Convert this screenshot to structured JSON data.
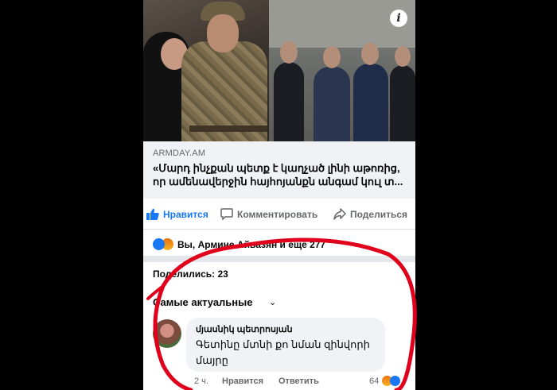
{
  "link": {
    "domain": "ARMDAY.AM",
    "title": "«Մարդ ինչքան պետք է կաղչած լինի աթոռից, որ ամենավերջին հայհոյանքն անգամ կուլ տ..."
  },
  "actions": {
    "like_label": "Нравится",
    "comment_label": "Комментировать",
    "share_label": "Поделиться"
  },
  "reactions": {
    "summary": "Вы, Армине Айвазян и ещё 277"
  },
  "shares": {
    "label": "Поделились: 23"
  },
  "sort": {
    "label": "Самые актуальные"
  },
  "comment": {
    "author": "մյասնիկ պետրոսյան",
    "text": "Գետինը մտնի քո նման զինվորի մայրը",
    "time": "2 ч.",
    "like_label": "Нравится",
    "reply_label": "Ответить",
    "reaction_count": "64"
  },
  "colors": {
    "accent": "#1877f2",
    "annotation": "#e0001b"
  }
}
